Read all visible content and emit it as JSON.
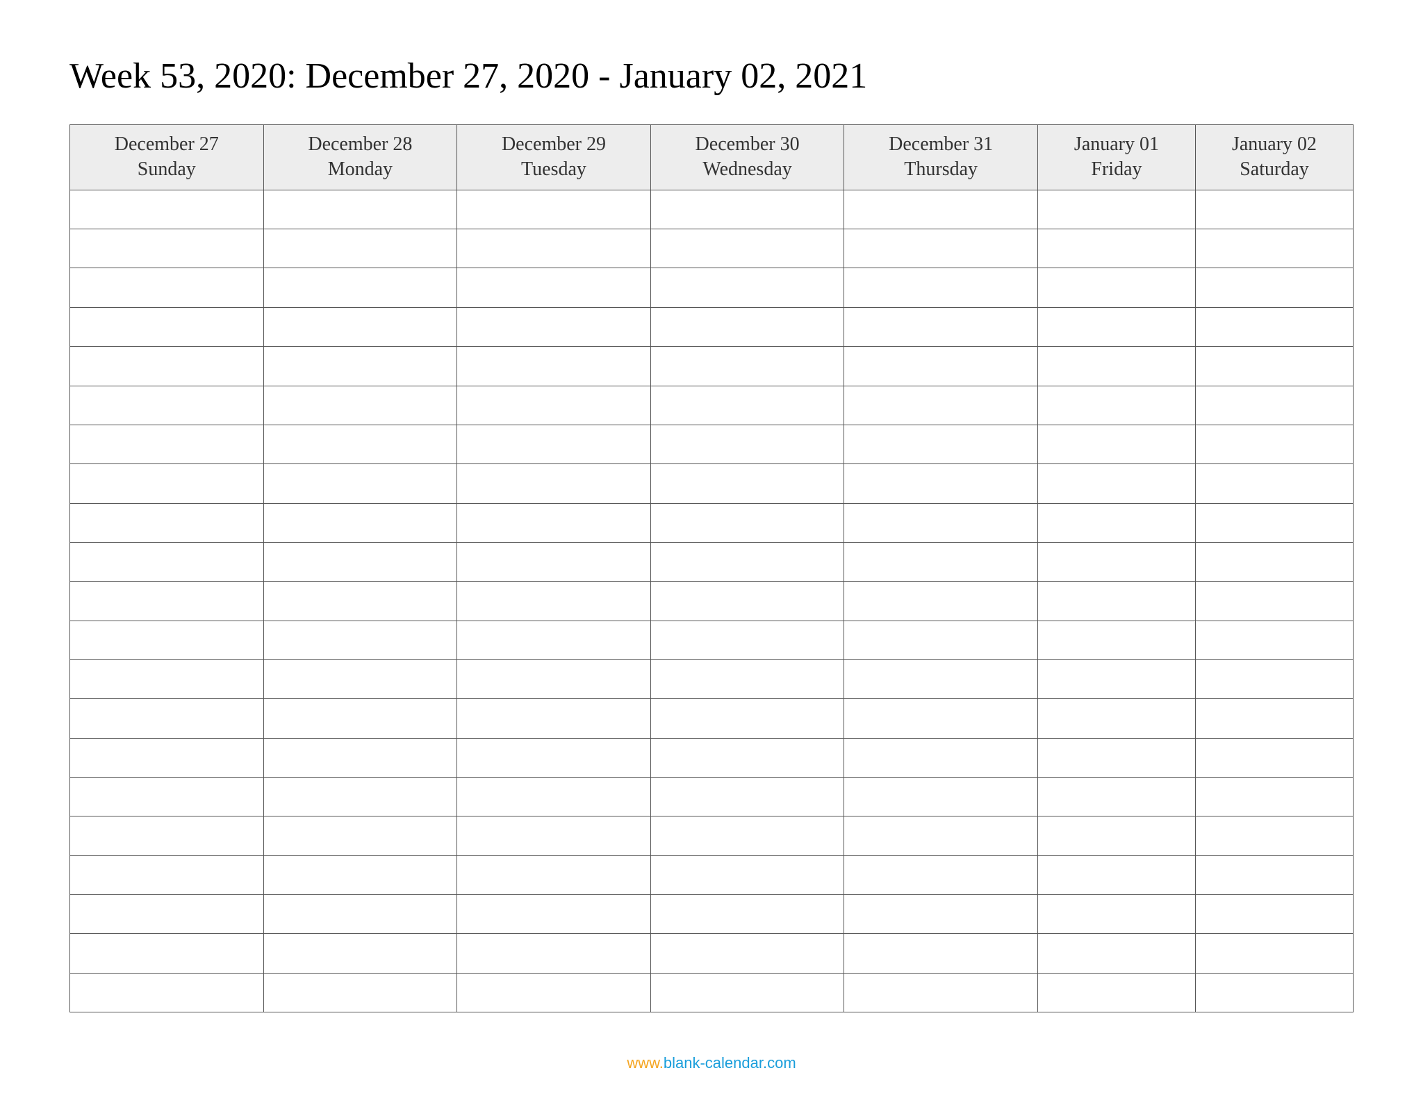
{
  "title": "Week 53, 2020: December 27, 2020 - January 02, 2021",
  "columns": [
    {
      "date": "December 27",
      "day": "Sunday"
    },
    {
      "date": "December 28",
      "day": "Monday"
    },
    {
      "date": "December 29",
      "day": "Tuesday"
    },
    {
      "date": "December 30",
      "day": "Wednesday"
    },
    {
      "date": "December 31",
      "day": "Thursday"
    },
    {
      "date": "January 01",
      "day": "Friday"
    },
    {
      "date": "January 02",
      "day": "Saturday"
    }
  ],
  "row_count": 21,
  "footer": {
    "prefix": "www.",
    "link": "blank-calendar.com"
  }
}
